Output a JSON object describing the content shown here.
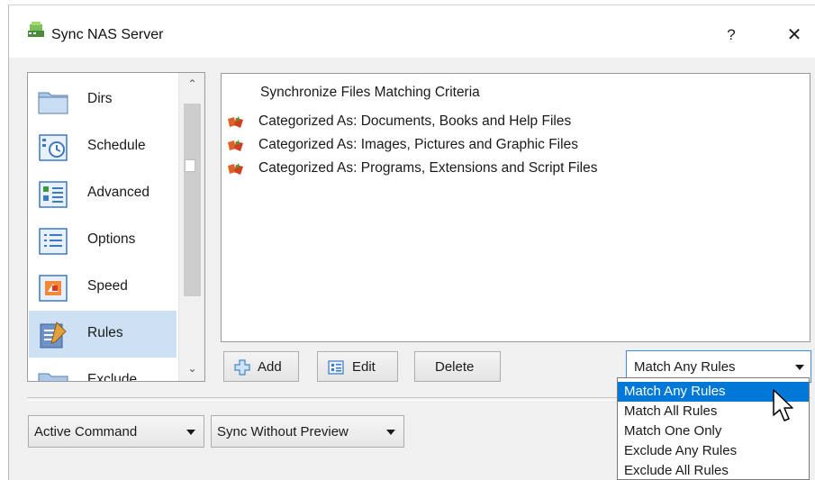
{
  "window": {
    "title": "Sync NAS Server",
    "help_label": "?",
    "close_label": "✕"
  },
  "sidebar": {
    "scroll_up": "⌃",
    "scroll_down": "⌄",
    "items": [
      {
        "label": "Dirs",
        "icon": "folder-icon"
      },
      {
        "label": "Schedule",
        "icon": "clock-icon"
      },
      {
        "label": "Advanced",
        "icon": "advanced-icon"
      },
      {
        "label": "Options",
        "icon": "list-icon"
      },
      {
        "label": "Speed",
        "icon": "speed-icon"
      },
      {
        "label": "Rules",
        "icon": "rules-icon",
        "selected": true
      },
      {
        "label": "Exclude",
        "icon": "exclude-icon"
      }
    ]
  },
  "rules": {
    "header": "Synchronize Files Matching Criteria",
    "items": [
      "Categorized As: Documents, Books and Help Files",
      "Categorized As: Images, Pictures and Graphic Files",
      "Categorized As: Programs, Extensions and Script Files"
    ]
  },
  "toolbar": {
    "add_label": "Add",
    "edit_label": "Edit",
    "delete_label": "Delete"
  },
  "match_combo": {
    "selected": "Match Any Rules",
    "options": [
      "Match Any Rules",
      "Match All Rules",
      "Match One Only",
      "Exclude Any Rules",
      "Exclude All Rules"
    ]
  },
  "bottom": {
    "command_combo": "Active Command",
    "mode_combo": "Sync Without Preview"
  },
  "colors": {
    "selection_blue": "#0078d7",
    "sidebar_selected": "#cde0f4"
  }
}
